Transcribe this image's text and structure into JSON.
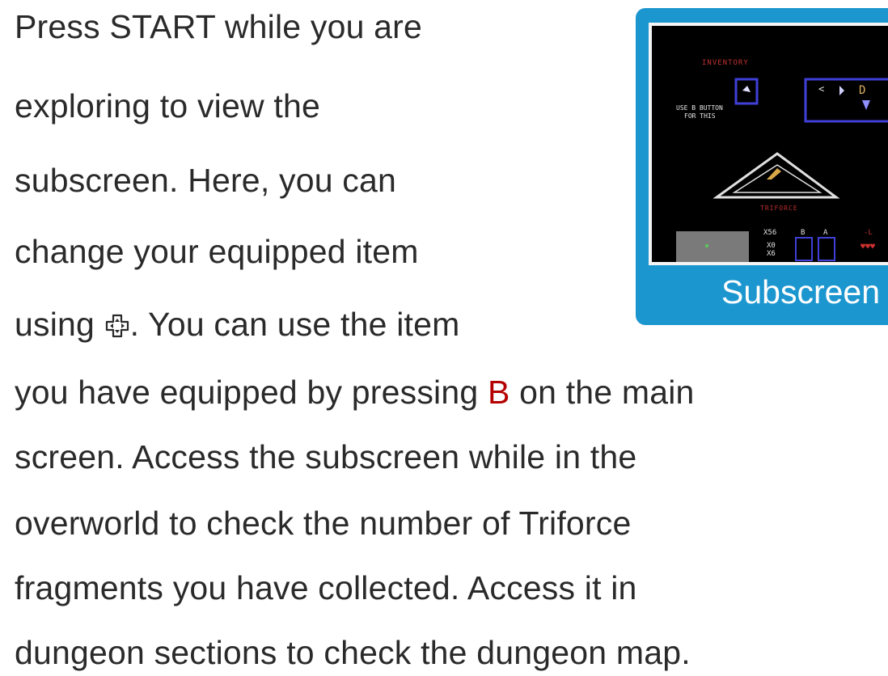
{
  "paragraph": {
    "line1": "Press START while you are",
    "line2": "exploring to view the",
    "line3": "subscreen. Here, you can",
    "line4": "change your equipped item",
    "line5_before": "using ",
    "line5_after": ". You can use the item",
    "line6_before": "you have equipped by pressing ",
    "line6_button": "B",
    "line6_after": " on the main",
    "line7": "screen. Access the subscreen while in the",
    "line8": "overworld to check the number of Triforce",
    "line9": "fragments you have collected. Access it in",
    "line10": "dungeon sections to check the dungeon map."
  },
  "icons": {
    "dpad": "dpad-icon"
  },
  "figure": {
    "caption": "Subscreen",
    "screen_text": {
      "inventory": "INVENTORY",
      "use_b_line1": "USE B BUTTON",
      "use_b_line2": "FOR THIS",
      "triforce": "TRIFORCE",
      "rupee_count": "X56",
      "key_count": "X0",
      "bomb_count": "X6",
      "b_label": "B",
      "a_label": "A"
    }
  },
  "colors": {
    "text": "#2a2a2a",
    "button_b": "#b40000",
    "figure_frame": "#1c96cf",
    "caption_text": "#ffffff"
  }
}
